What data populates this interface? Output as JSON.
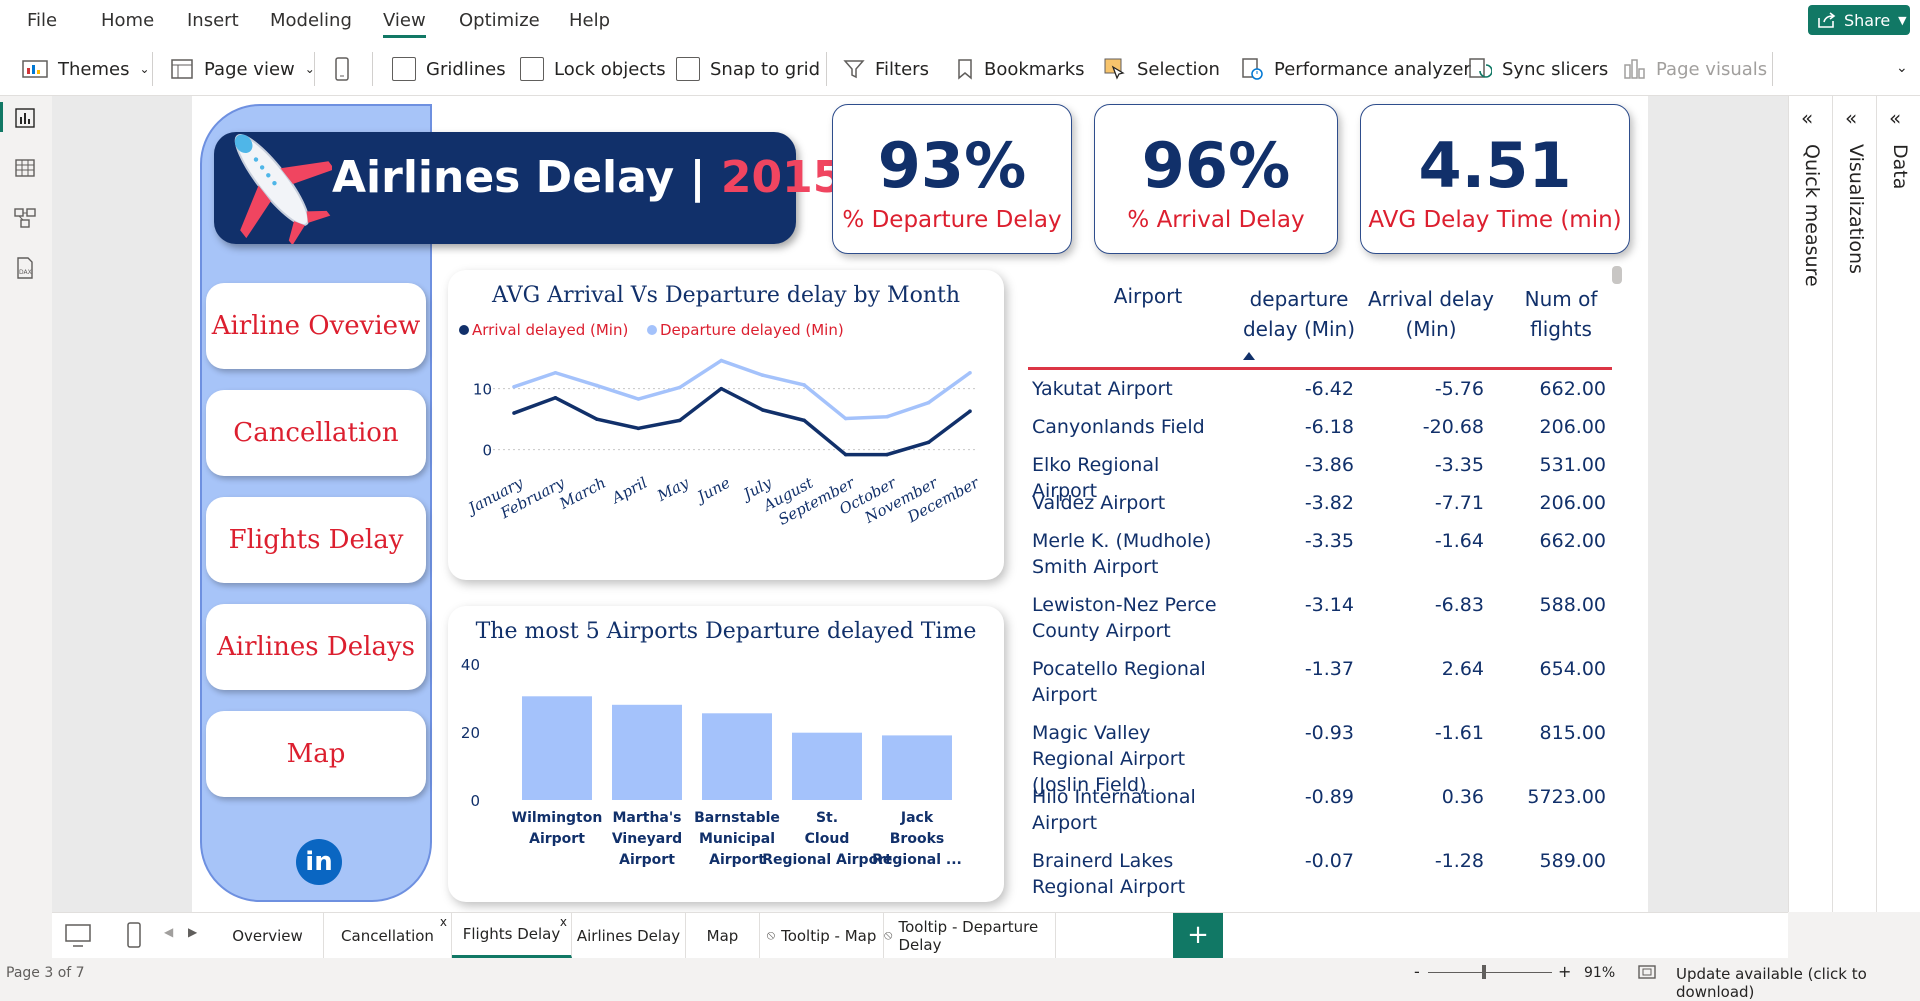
{
  "menu": {
    "items": [
      "File",
      "Home",
      "Insert",
      "Modeling",
      "View",
      "Optimize",
      "Help"
    ],
    "active": "View",
    "share_label": "Share"
  },
  "ribbon": {
    "themes": "Themes",
    "page_view": "Page view",
    "gridlines": "Gridlines",
    "lock_objects": "Lock objects",
    "snap_to_grid": "Snap to grid",
    "filters": "Filters",
    "bookmarks": "Bookmarks",
    "selection": "Selection",
    "performance_analyzer": "Performance analyzer",
    "sync_slicers": "Sync slicers",
    "page_visuals": "Page visuals"
  },
  "panes": {
    "data": "Data",
    "visualizations": "Visualizations",
    "quick_measure": "Quick measure"
  },
  "report": {
    "title_main": "Airlines Delay",
    "title_sep": "|",
    "title_year": "2015",
    "nav": [
      "Airline Oveview",
      "Cancellation",
      "Flights Delay",
      "Airlines Delays",
      "Map"
    ],
    "linkedin": "in",
    "kpis": [
      {
        "value": "93%",
        "label": "% Departure Delay"
      },
      {
        "value": "96%",
        "label": "% Arrival Delay"
      },
      {
        "value": "4.51",
        "label": "AVG Delay Time (min)"
      }
    ],
    "colors": {
      "navy": "#11306a",
      "red": "#dc1f2f",
      "light_blue": "#a4c2fb"
    }
  },
  "line_chart_data": {
    "type": "line",
    "title": "AVG Arrival Vs Departure delay by Month",
    "legend": [
      "Arrival delayed (Min)",
      "Departure delayed (Min)"
    ],
    "categories": [
      "January",
      "February",
      "March",
      "April",
      "May",
      "June",
      "July",
      "August",
      "September",
      "October",
      "November",
      "December"
    ],
    "series": [
      {
        "name": "Arrival delayed (Min)",
        "color": "#11306a",
        "values": [
          6,
          8.5,
          5,
          3.5,
          4.8,
          10,
          6.5,
          4.8,
          -0.8,
          -0.8,
          1.2,
          6.3
        ]
      },
      {
        "name": "Departure delayed (Min)",
        "color": "#a4c2fb",
        "values": [
          10.3,
          12.6,
          10.5,
          8.3,
          10.2,
          14.6,
          12.2,
          10.6,
          5.1,
          5.4,
          7.7,
          12.6
        ]
      }
    ],
    "yticks": [
      0,
      10
    ],
    "ylim": [
      -3,
      16
    ]
  },
  "chart_data": {
    "type": "bar",
    "title": "The most 5 Airports Departure delayed Time",
    "categories": [
      "Wilmington Airport",
      "Martha's Vineyard Airport",
      "Barnstable Municipal Airport",
      "St. Cloud Regional Airport",
      "Jack Brooks Regional ..."
    ],
    "values": [
      30.5,
      28,
      25.5,
      19.8,
      19
    ],
    "yticks": [
      0,
      20,
      40
    ],
    "ylim": [
      0,
      40
    ],
    "color": "#a4c2fb"
  },
  "table": {
    "headers": [
      "Airport",
      "departure delay (Min)",
      "Arrival delay (Min)",
      "Num of flights"
    ],
    "rows": [
      [
        "Yakutat Airport",
        "-6.42",
        "-5.76",
        "662.00"
      ],
      [
        "Canyonlands Field",
        "-6.18",
        "-20.68",
        "206.00"
      ],
      [
        "Elko Regional Airport",
        "-3.86",
        "-3.35",
        "531.00"
      ],
      [
        "Valdez Airport",
        "-3.82",
        "-7.71",
        "206.00"
      ],
      [
        "Merle K. (Mudhole) Smith Airport",
        "-3.35",
        "-1.64",
        "662.00"
      ],
      [
        "Lewiston-Nez Perce County Airport",
        "-3.14",
        "-6.83",
        "588.00"
      ],
      [
        "Pocatello Regional Airport",
        "-1.37",
        "2.64",
        "654.00"
      ],
      [
        "Magic Valley Regional Airport (Joslin Field)",
        "-0.93",
        "-1.61",
        "815.00"
      ],
      [
        "Hilo International Airport",
        "-0.89",
        "0.36",
        "5723.00"
      ],
      [
        "Brainerd Lakes Regional Airport",
        "-0.07",
        "-1.28",
        "589.00"
      ]
    ]
  },
  "tabs": [
    {
      "label": "Overview"
    },
    {
      "label": "Cancellation",
      "close": "x"
    },
    {
      "label": "Flights Delay",
      "close": "x",
      "active": true
    },
    {
      "label": "Airlines Delay"
    },
    {
      "label": "Map"
    },
    {
      "label": "Tooltip - Map",
      "hidden": true
    },
    {
      "label": "Tooltip - Departure Delay",
      "hidden": true
    }
  ],
  "status": {
    "page": "Page 3 of 7",
    "zoom_minus": "-",
    "zoom_plus": "+",
    "zoom": "91%",
    "update": "Update available (click to download)"
  }
}
